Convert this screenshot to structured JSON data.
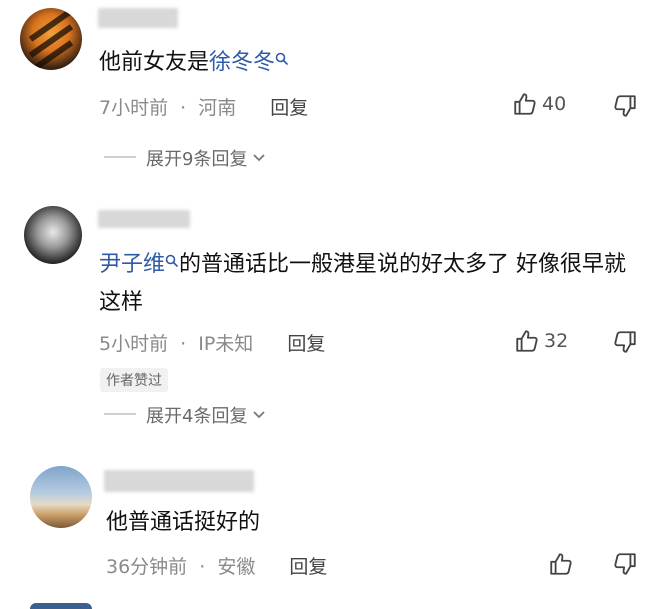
{
  "comments": [
    {
      "pre_text": "他前女友是",
      "mention": "徐冬冬",
      "post_text": "",
      "time": "7小时前",
      "sep": "·",
      "location": "河南",
      "reply_label": "回复",
      "likes": "40",
      "expand_label": "展开9条回复"
    },
    {
      "pre_text": "",
      "mention": "尹子维",
      "post_text": "的普通话比一般港星说的好太多了  好像很早就这样",
      "time": "5小时前",
      "sep": "·",
      "location": "IP未知",
      "reply_label": "回复",
      "likes": "32",
      "badge": "作者赞过",
      "expand_label": "展开4条回复"
    },
    {
      "pre_text": "他普通话挺好的",
      "mention": "",
      "post_text": "",
      "time": "36分钟前",
      "sep": "·",
      "location": "安徽",
      "reply_label": "回复",
      "likes": ""
    }
  ],
  "icons": {
    "search_icon": "search-icon",
    "like_icon": "thumb-up-icon",
    "dislike_icon": "thumb-down-icon",
    "chevron": "chevron-down-icon"
  },
  "colors": {
    "mention": "#2f5aa8",
    "meta": "#8a8a8a"
  }
}
